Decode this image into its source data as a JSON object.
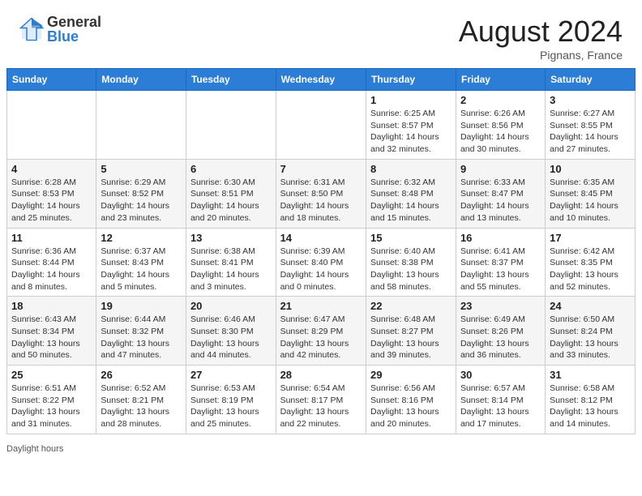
{
  "header": {
    "logo_general": "General",
    "logo_blue": "Blue",
    "month_title": "August 2024",
    "location": "Pignans, France"
  },
  "footer": {
    "daylight_label": "Daylight hours"
  },
  "days_of_week": [
    "Sunday",
    "Monday",
    "Tuesday",
    "Wednesday",
    "Thursday",
    "Friday",
    "Saturday"
  ],
  "weeks": [
    [
      {
        "num": "",
        "info": ""
      },
      {
        "num": "",
        "info": ""
      },
      {
        "num": "",
        "info": ""
      },
      {
        "num": "",
        "info": ""
      },
      {
        "num": "1",
        "info": "Sunrise: 6:25 AM\nSunset: 8:57 PM\nDaylight: 14 hours and 32 minutes."
      },
      {
        "num": "2",
        "info": "Sunrise: 6:26 AM\nSunset: 8:56 PM\nDaylight: 14 hours and 30 minutes."
      },
      {
        "num": "3",
        "info": "Sunrise: 6:27 AM\nSunset: 8:55 PM\nDaylight: 14 hours and 27 minutes."
      }
    ],
    [
      {
        "num": "4",
        "info": "Sunrise: 6:28 AM\nSunset: 8:53 PM\nDaylight: 14 hours and 25 minutes."
      },
      {
        "num": "5",
        "info": "Sunrise: 6:29 AM\nSunset: 8:52 PM\nDaylight: 14 hours and 23 minutes."
      },
      {
        "num": "6",
        "info": "Sunrise: 6:30 AM\nSunset: 8:51 PM\nDaylight: 14 hours and 20 minutes."
      },
      {
        "num": "7",
        "info": "Sunrise: 6:31 AM\nSunset: 8:50 PM\nDaylight: 14 hours and 18 minutes."
      },
      {
        "num": "8",
        "info": "Sunrise: 6:32 AM\nSunset: 8:48 PM\nDaylight: 14 hours and 15 minutes."
      },
      {
        "num": "9",
        "info": "Sunrise: 6:33 AM\nSunset: 8:47 PM\nDaylight: 14 hours and 13 minutes."
      },
      {
        "num": "10",
        "info": "Sunrise: 6:35 AM\nSunset: 8:45 PM\nDaylight: 14 hours and 10 minutes."
      }
    ],
    [
      {
        "num": "11",
        "info": "Sunrise: 6:36 AM\nSunset: 8:44 PM\nDaylight: 14 hours and 8 minutes."
      },
      {
        "num": "12",
        "info": "Sunrise: 6:37 AM\nSunset: 8:43 PM\nDaylight: 14 hours and 5 minutes."
      },
      {
        "num": "13",
        "info": "Sunrise: 6:38 AM\nSunset: 8:41 PM\nDaylight: 14 hours and 3 minutes."
      },
      {
        "num": "14",
        "info": "Sunrise: 6:39 AM\nSunset: 8:40 PM\nDaylight: 14 hours and 0 minutes."
      },
      {
        "num": "15",
        "info": "Sunrise: 6:40 AM\nSunset: 8:38 PM\nDaylight: 13 hours and 58 minutes."
      },
      {
        "num": "16",
        "info": "Sunrise: 6:41 AM\nSunset: 8:37 PM\nDaylight: 13 hours and 55 minutes."
      },
      {
        "num": "17",
        "info": "Sunrise: 6:42 AM\nSunset: 8:35 PM\nDaylight: 13 hours and 52 minutes."
      }
    ],
    [
      {
        "num": "18",
        "info": "Sunrise: 6:43 AM\nSunset: 8:34 PM\nDaylight: 13 hours and 50 minutes."
      },
      {
        "num": "19",
        "info": "Sunrise: 6:44 AM\nSunset: 8:32 PM\nDaylight: 13 hours and 47 minutes."
      },
      {
        "num": "20",
        "info": "Sunrise: 6:46 AM\nSunset: 8:30 PM\nDaylight: 13 hours and 44 minutes."
      },
      {
        "num": "21",
        "info": "Sunrise: 6:47 AM\nSunset: 8:29 PM\nDaylight: 13 hours and 42 minutes."
      },
      {
        "num": "22",
        "info": "Sunrise: 6:48 AM\nSunset: 8:27 PM\nDaylight: 13 hours and 39 minutes."
      },
      {
        "num": "23",
        "info": "Sunrise: 6:49 AM\nSunset: 8:26 PM\nDaylight: 13 hours and 36 minutes."
      },
      {
        "num": "24",
        "info": "Sunrise: 6:50 AM\nSunset: 8:24 PM\nDaylight: 13 hours and 33 minutes."
      }
    ],
    [
      {
        "num": "25",
        "info": "Sunrise: 6:51 AM\nSunset: 8:22 PM\nDaylight: 13 hours and 31 minutes."
      },
      {
        "num": "26",
        "info": "Sunrise: 6:52 AM\nSunset: 8:21 PM\nDaylight: 13 hours and 28 minutes."
      },
      {
        "num": "27",
        "info": "Sunrise: 6:53 AM\nSunset: 8:19 PM\nDaylight: 13 hours and 25 minutes."
      },
      {
        "num": "28",
        "info": "Sunrise: 6:54 AM\nSunset: 8:17 PM\nDaylight: 13 hours and 22 minutes."
      },
      {
        "num": "29",
        "info": "Sunrise: 6:56 AM\nSunset: 8:16 PM\nDaylight: 13 hours and 20 minutes."
      },
      {
        "num": "30",
        "info": "Sunrise: 6:57 AM\nSunset: 8:14 PM\nDaylight: 13 hours and 17 minutes."
      },
      {
        "num": "31",
        "info": "Sunrise: 6:58 AM\nSunset: 8:12 PM\nDaylight: 13 hours and 14 minutes."
      }
    ]
  ]
}
